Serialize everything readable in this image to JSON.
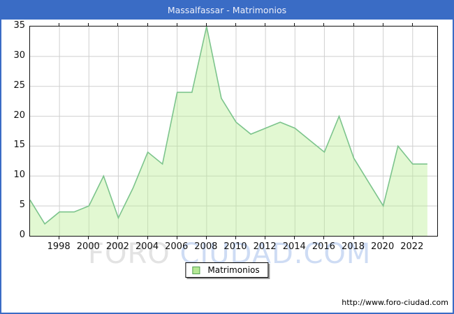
{
  "window": {
    "title": "Massalfassar - Matrimonios",
    "accent_color": "#3a6cc5"
  },
  "chart_data": {
    "type": "area",
    "title": "Massalfassar - Matrimonios",
    "series_name": "Matrimonios",
    "x": [
      1996,
      1997,
      1998,
      1999,
      2000,
      2001,
      2002,
      2003,
      2004,
      2005,
      2006,
      2007,
      2008,
      2009,
      2010,
      2011,
      2012,
      2013,
      2014,
      2015,
      2016,
      2017,
      2018,
      2019,
      2020,
      2021,
      2022,
      2023
    ],
    "values": [
      6,
      2,
      4,
      4,
      5,
      10,
      3,
      8,
      14,
      12,
      24,
      24,
      35,
      23,
      19,
      17,
      18,
      19,
      18,
      16,
      14,
      20,
      13,
      9,
      5,
      15,
      12,
      12
    ],
    "xticks": [
      1998,
      2000,
      2002,
      2004,
      2006,
      2008,
      2010,
      2012,
      2014,
      2016,
      2018,
      2020,
      2022
    ],
    "yticks": [
      0,
      5,
      10,
      15,
      20,
      25,
      30,
      35
    ],
    "ylim": [
      0,
      35
    ],
    "xlim": [
      1996,
      2023.8
    ],
    "grid": true,
    "legend_position": "bottom-center",
    "colors": {
      "line": "#7cc48c",
      "fill": "rgba(186,238,148,0.42)",
      "grid": "#cfcfcf",
      "plot_border": "#111111"
    }
  },
  "legend": {
    "label": "Matrimonios"
  },
  "watermark": {
    "part1": "FORO ",
    "part2": "CIUDAD.COM"
  },
  "footer": {
    "url": "http://www.foro-ciudad.com"
  }
}
